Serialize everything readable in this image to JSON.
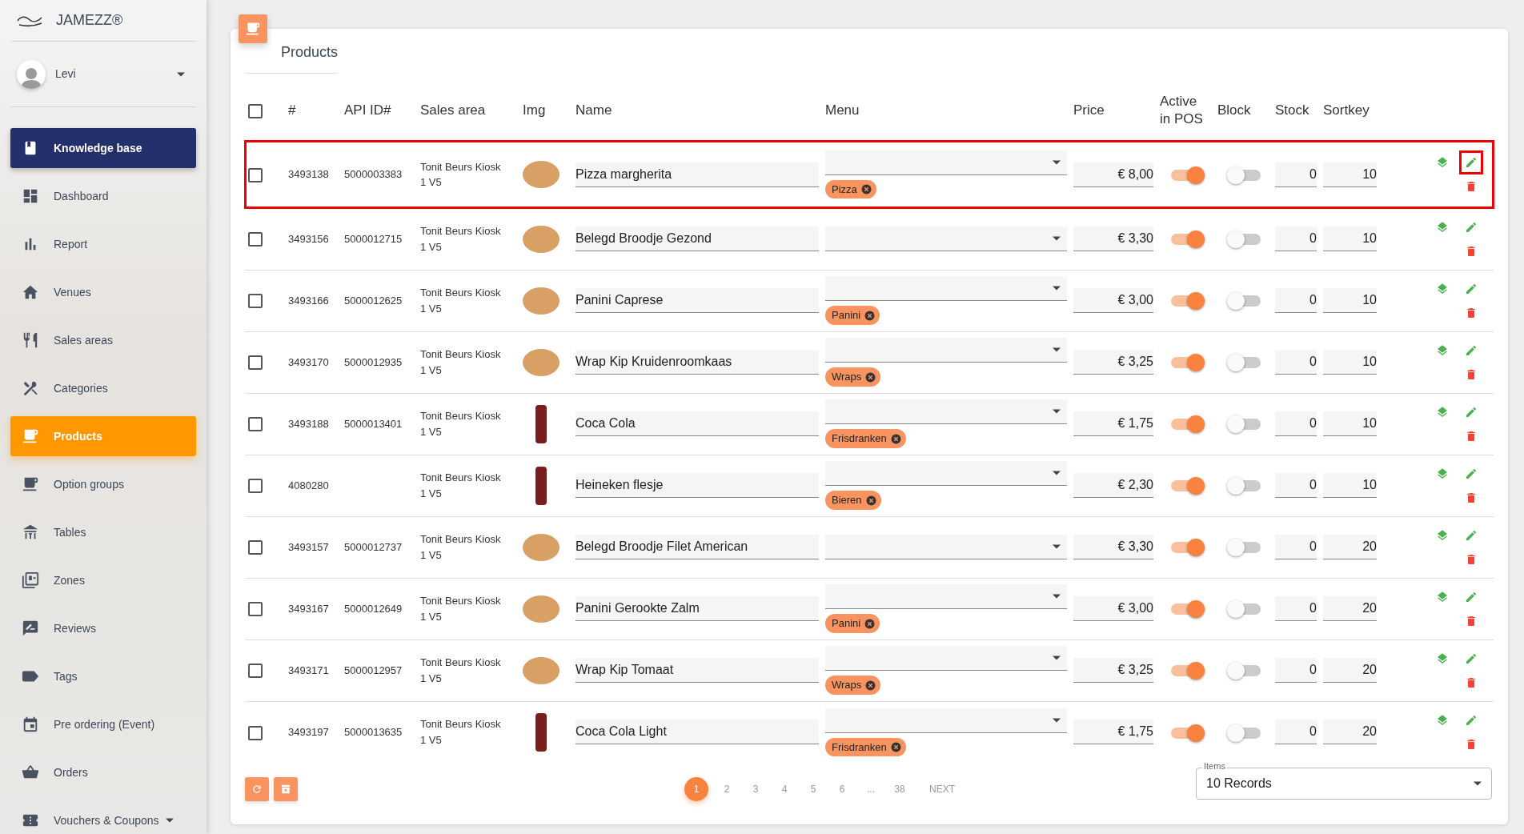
{
  "brand": {
    "name": "JAMEZZ®"
  },
  "user": {
    "name": "Levi"
  },
  "sidebar": {
    "items": [
      {
        "label": "Knowledge base",
        "kind": "feature",
        "selected": false,
        "has_submenu": false
      },
      {
        "label": "Dashboard",
        "kind": "link",
        "selected": false,
        "has_submenu": false
      },
      {
        "label": "Report",
        "kind": "link",
        "selected": false,
        "has_submenu": false
      },
      {
        "label": "Venues",
        "kind": "link",
        "selected": false,
        "has_submenu": false
      },
      {
        "label": "Sales areas",
        "kind": "link",
        "selected": false,
        "has_submenu": false
      },
      {
        "label": "Categories",
        "kind": "link",
        "selected": false,
        "has_submenu": false
      },
      {
        "label": "Products",
        "kind": "link",
        "selected": true,
        "has_submenu": false
      },
      {
        "label": "Option groups",
        "kind": "link",
        "selected": false,
        "has_submenu": false
      },
      {
        "label": "Tables",
        "kind": "link",
        "selected": false,
        "has_submenu": false
      },
      {
        "label": "Zones",
        "kind": "link",
        "selected": false,
        "has_submenu": false
      },
      {
        "label": "Reviews",
        "kind": "link",
        "selected": false,
        "has_submenu": false
      },
      {
        "label": "Tags",
        "kind": "link",
        "selected": false,
        "has_submenu": false
      },
      {
        "label": "Pre ordering (Event)",
        "kind": "link",
        "selected": false,
        "has_submenu": false
      },
      {
        "label": "Orders",
        "kind": "link",
        "selected": false,
        "has_submenu": false
      },
      {
        "label": "Vouchers & Coupons",
        "kind": "link",
        "selected": false,
        "has_submenu": true
      }
    ]
  },
  "page": {
    "title": "Products"
  },
  "table": {
    "select_all_checked": false,
    "columns": [
      "#",
      "API ID#",
      "Sales area",
      "Img",
      "Name",
      "Menu",
      "Price",
      "Active in POS",
      "Block",
      "Stock",
      "Sortkey"
    ],
    "rows": [
      {
        "id": "3493138",
        "api_id": "5000003383",
        "sales_area": [
          "Tonit Beurs Kiosk",
          "1 V5"
        ],
        "name": "Pizza margherita",
        "menu_tag": "Pizza",
        "price": "€ 8,00",
        "active": true,
        "block": false,
        "stock": "0",
        "sortkey": "10",
        "checked": false,
        "highlighted": true
      },
      {
        "id": "3493156",
        "api_id": "5000012715",
        "sales_area": [
          "Tonit Beurs Kiosk",
          "1 V5"
        ],
        "name": "Belegd Broodje Gezond",
        "price": "€ 3,30",
        "active": true,
        "block": false,
        "stock": "0",
        "sortkey": "10",
        "checked": false,
        "highlighted": false
      },
      {
        "id": "3493166",
        "api_id": "5000012625",
        "sales_area": [
          "Tonit Beurs Kiosk",
          "1 V5"
        ],
        "name": "Panini Caprese",
        "menu_tag": "Panini",
        "price": "€ 3,00",
        "active": true,
        "block": false,
        "stock": "0",
        "sortkey": "10",
        "checked": false,
        "highlighted": false
      },
      {
        "id": "3493170",
        "api_id": "5000012935",
        "sales_area": [
          "Tonit Beurs Kiosk",
          "1 V5"
        ],
        "name": "Wrap Kip Kruidenroomkaas",
        "menu_tag": "Wraps",
        "price": "€ 3,25",
        "active": true,
        "block": false,
        "stock": "0",
        "sortkey": "10",
        "checked": false,
        "highlighted": false
      },
      {
        "id": "3493188",
        "api_id": "5000013401",
        "sales_area": [
          "Tonit Beurs Kiosk",
          "1 V5"
        ],
        "name": "Coca Cola",
        "menu_tag": "Frisdranken",
        "price": "€ 1,75",
        "active": true,
        "block": false,
        "stock": "0",
        "sortkey": "10",
        "checked": false,
        "highlighted": false
      },
      {
        "id": "4080280",
        "sales_area": [
          "Tonit Beurs Kiosk",
          "1 V5"
        ],
        "name": "Heineken flesje",
        "menu_tag": "Bieren",
        "price": "€ 2,30",
        "active": true,
        "block": false,
        "stock": "0",
        "sortkey": "10",
        "checked": false,
        "highlighted": false
      },
      {
        "id": "3493157",
        "api_id": "5000012737",
        "sales_area": [
          "Tonit Beurs Kiosk",
          "1 V5"
        ],
        "name": "Belegd Broodje Filet American",
        "price": "€ 3,30",
        "active": true,
        "block": false,
        "stock": "0",
        "sortkey": "20",
        "checked": false,
        "highlighted": false
      },
      {
        "id": "3493167",
        "api_id": "5000012649",
        "sales_area": [
          "Tonit Beurs Kiosk",
          "1 V5"
        ],
        "name": "Panini Gerookte Zalm",
        "menu_tag": "Panini",
        "price": "€ 3,00",
        "active": true,
        "block": false,
        "stock": "0",
        "sortkey": "20",
        "checked": false,
        "highlighted": false
      },
      {
        "id": "3493171",
        "api_id": "5000012957",
        "sales_area": [
          "Tonit Beurs Kiosk",
          "1 V5"
        ],
        "name": "Wrap Kip Tomaat",
        "menu_tag": "Wraps",
        "price": "€ 3,25",
        "active": true,
        "block": false,
        "stock": "0",
        "sortkey": "20",
        "checked": false,
        "highlighted": false
      },
      {
        "id": "3493197",
        "api_id": "5000013635",
        "sales_area": [
          "Tonit Beurs Kiosk",
          "1 V5"
        ],
        "name": "Coca Cola Light",
        "menu_tag": "Frisdranken",
        "price": "€ 1,75",
        "active": true,
        "block": false,
        "stock": "0",
        "sortkey": "20",
        "checked": false,
        "highlighted": false
      }
    ]
  },
  "pagination": {
    "pages": [
      {
        "label": "1",
        "selected": true
      },
      {
        "label": "2",
        "selected": false
      },
      {
        "label": "3",
        "selected": false
      },
      {
        "label": "4",
        "selected": false
      },
      {
        "label": "5",
        "selected": false
      },
      {
        "label": "6",
        "selected": false
      },
      {
        "label": "...",
        "selected": false
      },
      {
        "label": "38",
        "selected": false
      }
    ],
    "next": "NEXT"
  },
  "items_select": {
    "label": "Items",
    "value": "10 Records"
  }
}
